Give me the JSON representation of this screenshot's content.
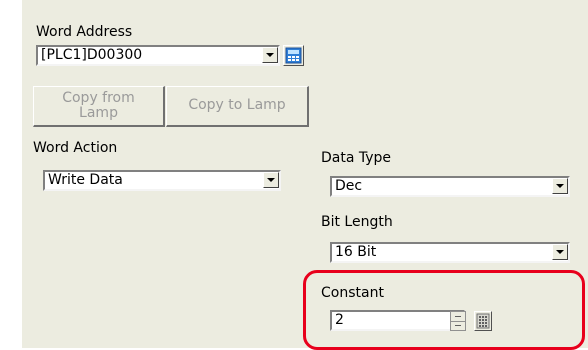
{
  "word_address": {
    "label": "Word Address",
    "value": "[PLC1]D00300",
    "calculator_icon": "calculator-icon"
  },
  "buttons": {
    "copy_from_lamp_line1": "Copy from",
    "copy_from_lamp_line2": "Lamp",
    "copy_to_lamp": "Copy to Lamp"
  },
  "word_action": {
    "label": "Word Action",
    "value": "Write Data"
  },
  "data_type": {
    "label": "Data Type",
    "value": "Dec"
  },
  "bit_length": {
    "label": "Bit Length",
    "value": "16 Bit"
  },
  "constant": {
    "label": "Constant",
    "value": "2",
    "keypad_icon": "keypad-icon"
  },
  "highlight_color": "#e8001c"
}
